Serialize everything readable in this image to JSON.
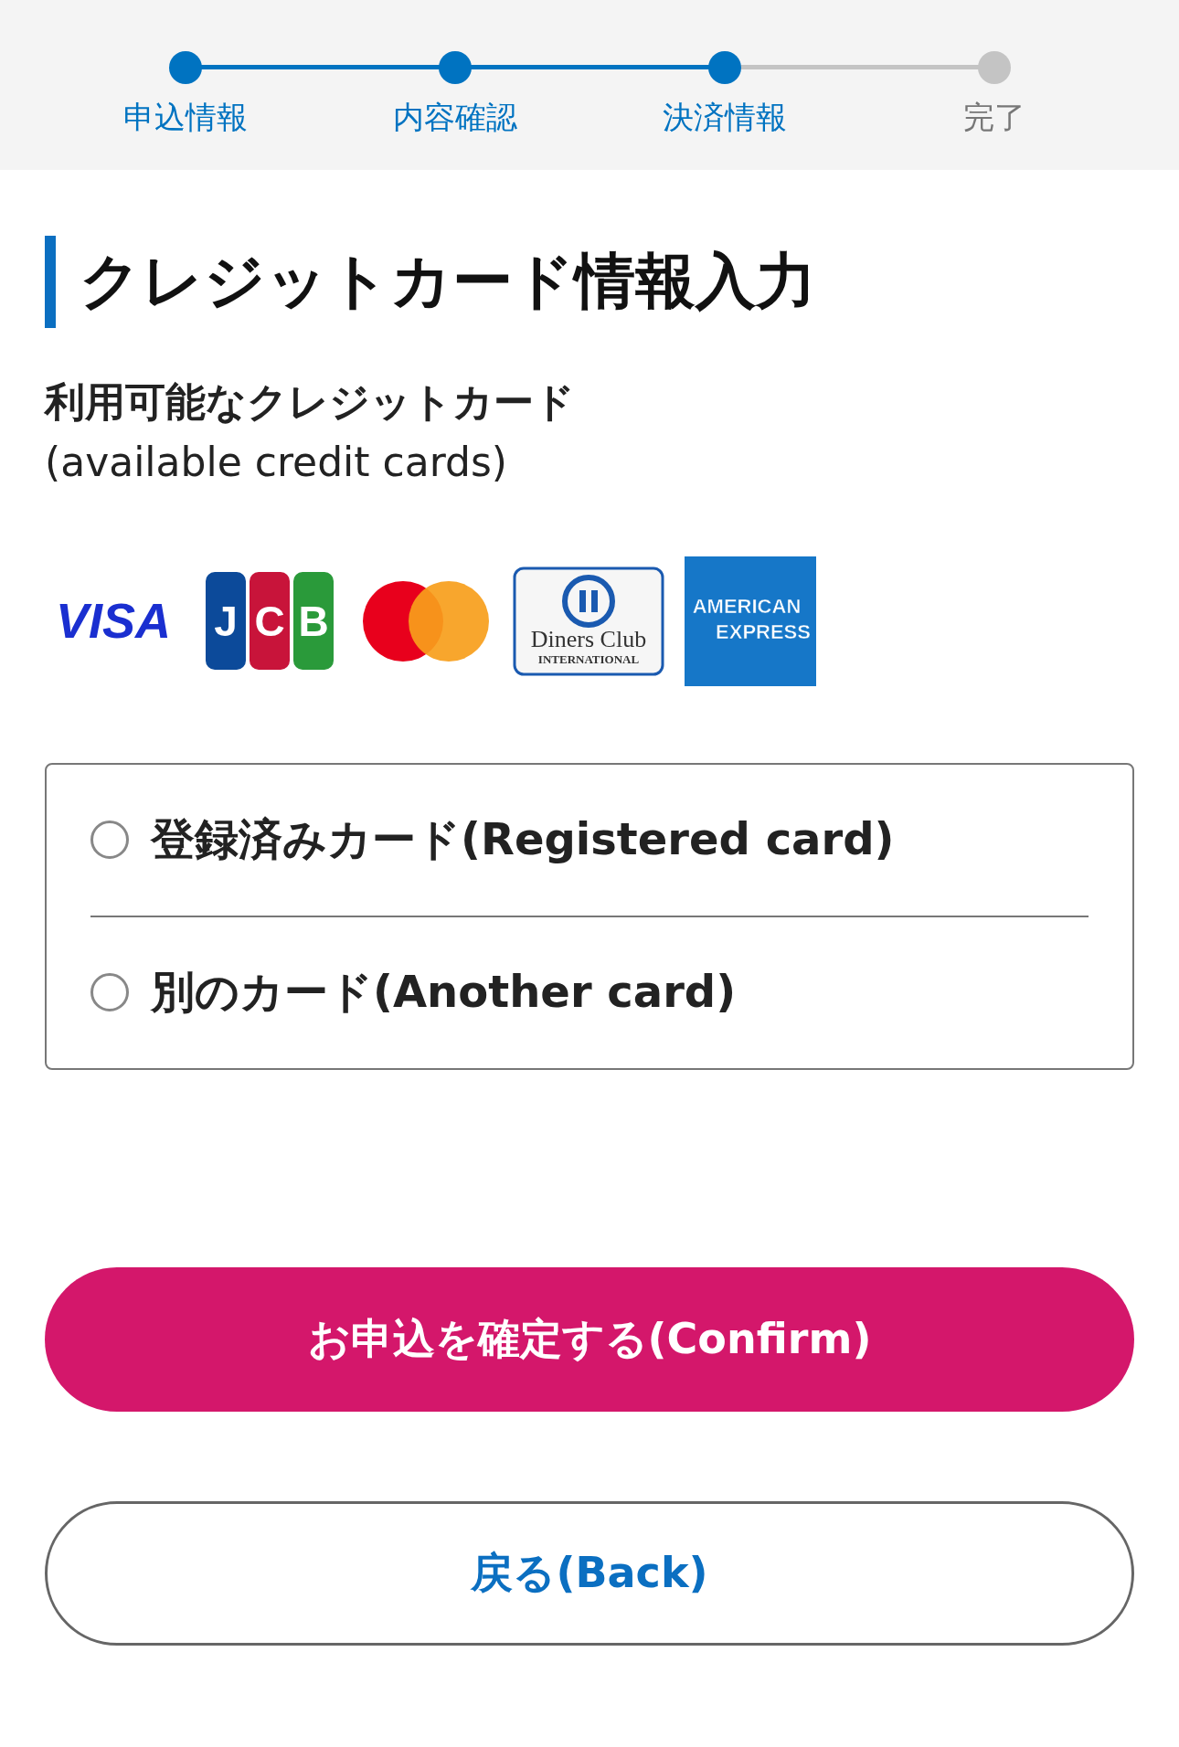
{
  "steps": [
    {
      "label": "申込情報",
      "reached": true
    },
    {
      "label": "内容確認",
      "reached": true
    },
    {
      "label": "決済情報",
      "reached": true
    },
    {
      "label": "完了",
      "reached": false
    }
  ],
  "heading": "クレジットカード情報入力",
  "cards_title": [
    "利用可能なクレジットカード",
    "(available credit cards)"
  ],
  "card_logos": [
    {
      "kind": "visa",
      "lines": [
        "VISA"
      ]
    },
    {
      "kind": "jcb",
      "lines": [
        "J",
        "C",
        "B"
      ]
    },
    {
      "kind": "mastercard"
    },
    {
      "kind": "diners",
      "lines": [
        "Diners Club",
        "INTERNATIONAL"
      ]
    },
    {
      "kind": "amex",
      "lines": [
        "AMERICAN",
        "EXPRESS"
      ]
    }
  ],
  "card_options": [
    {
      "label": "登録済みカード(Registered card)",
      "selected": false
    },
    {
      "label": "別のカード(Another card)",
      "selected": false
    }
  ],
  "buttons": [
    {
      "kind": "primary",
      "label": "お申込を確定する(Confirm)"
    },
    {
      "kind": "secondary",
      "label": "戻る(Back)"
    }
  ]
}
